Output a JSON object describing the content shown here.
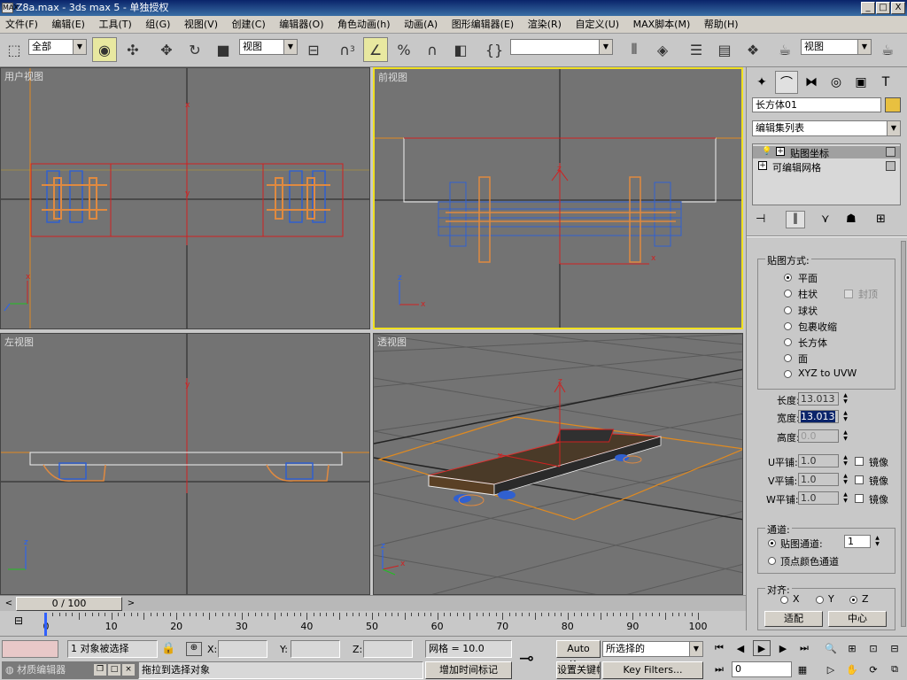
{
  "window": {
    "title": "Z8a.max - 3ds max 5 - 单独授权",
    "app_icon": "MAX",
    "controls": [
      "_",
      "□",
      "X"
    ]
  },
  "menus": [
    "文件(F)",
    "编辑(E)",
    "工具(T)",
    "组(G)",
    "视图(V)",
    "创建(C)",
    "编辑器(O)",
    "角色动画(h)",
    "动画(A)",
    "图形编辑器(E)",
    "渲染(R)",
    "自定义(U)",
    "MAX脚本(M)",
    "帮助(H)"
  ],
  "toolbar": {
    "selection_filter": "全部",
    "ref_coord": "视图",
    "named_selection": "",
    "render_view": "视图",
    "snap_label": "3"
  },
  "viewports": {
    "top_left": {
      "label": "用户视图"
    },
    "top_right": {
      "label": "前视图"
    },
    "bottom_left": {
      "label": "左视图"
    },
    "bottom_right": {
      "label": "透视图"
    },
    "axis_x": "x",
    "axis_y": "y",
    "axis_z": "z"
  },
  "command_panel": {
    "object_name": "长方体01",
    "object_color": "#e8c040",
    "modifier_list": "编辑集列表",
    "stack": [
      {
        "label": "贴图坐标",
        "active": true
      },
      {
        "label": "可编辑网格",
        "active": false
      }
    ],
    "mapping_title": "贴图方式:",
    "mapping_options": [
      "平面",
      "柱状",
      "球状",
      "包裹收缩",
      "长方体",
      "面",
      "XYZ to UVW"
    ],
    "mapping_selected": 0,
    "cap_label": "封顶",
    "length_label": "长度:",
    "length_value": "13.013",
    "width_label": "宽度:",
    "width_value": "13.013",
    "height_label": "高度:",
    "height_value": "0.0",
    "u_tile_label": "U平铺:",
    "u_tile": "1.0",
    "v_tile_label": "V平铺:",
    "v_tile": "1.0",
    "w_tile_label": "W平铺:",
    "w_tile": "1.0",
    "mirror_label": "镜像",
    "channel_title": "通道:",
    "map_channel_label": "贴图通道:",
    "map_channel_value": "1",
    "vertex_color_label": "顶点颜色通道",
    "align_title": "对齐:",
    "align_x": "X",
    "align_y": "Y",
    "align_z": "Z",
    "fit_button": "适配",
    "center_button": "中心"
  },
  "timeline": {
    "frame_display": "0 / 100",
    "ticks": [
      "0",
      "10",
      "20",
      "30",
      "40",
      "50",
      "60",
      "70",
      "80",
      "90",
      "100"
    ]
  },
  "status": {
    "selection_info": "1 对象被选择",
    "x_label": "X:",
    "y_label": "Y:",
    "z_label": "Z:",
    "grid_label": "网格 = 10.0",
    "prompt": "拖拉到选择对象",
    "add_time_tag": "增加时间标记",
    "auto_key": "Auto Key",
    "set_key": "设置关键帧",
    "key_target": "所选择的",
    "key_filters": "Key Filters...",
    "current_frame": "0",
    "material_editor": "材质编辑器"
  }
}
